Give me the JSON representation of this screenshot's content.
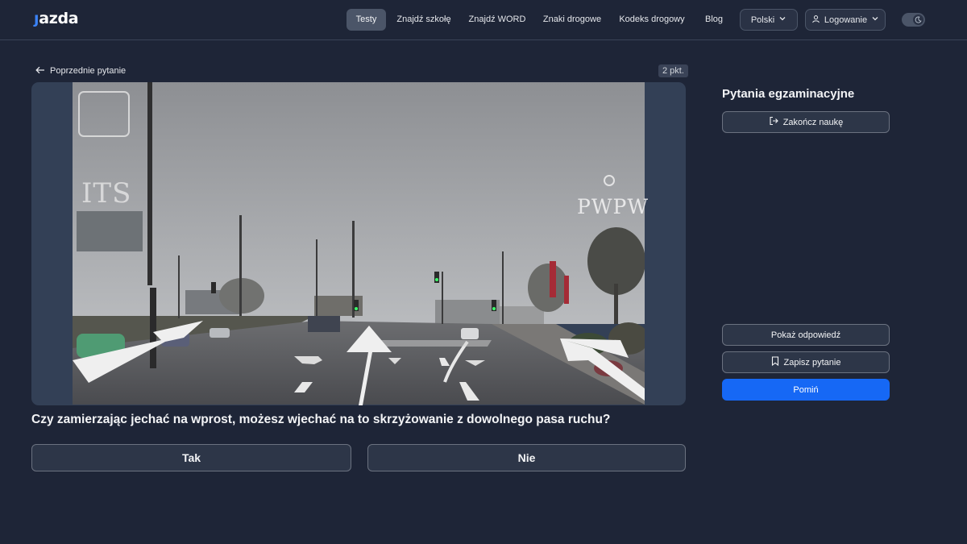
{
  "header": {
    "logo_text": "azda",
    "nav": [
      {
        "label": "Testy",
        "active": true
      },
      {
        "label": "Znajdź szkołę"
      },
      {
        "label": "Znajdź WORD"
      },
      {
        "label": "Znaki drogowe"
      },
      {
        "label": "Kodeks drogowy"
      },
      {
        "label": "Blog"
      }
    ],
    "language_label": "Polski",
    "login_label": "Logowanie",
    "theme_icon": "moon-icon"
  },
  "question": {
    "back_label": "Poprzednie pytanie",
    "points": "2 pkt.",
    "text": "Czy zamierzając jechać na wprost, możesz wjechać na to skrzyżowanie z dowolnego pasa ruchu?",
    "media_watermarks": {
      "left": "ITS",
      "right": "PWPW"
    },
    "answers": [
      "Tak",
      "Nie"
    ]
  },
  "side": {
    "title": "Pytania egzaminacyjne",
    "finish_label": "Zakończ naukę",
    "show_answer_label": "Pokaż odpowiedź",
    "save_label": "Zapisz pytanie",
    "skip_label": "Pomiń"
  },
  "colors": {
    "background": "#1e2537",
    "primary": "#1668f5",
    "nav_active": "#4b5568"
  }
}
